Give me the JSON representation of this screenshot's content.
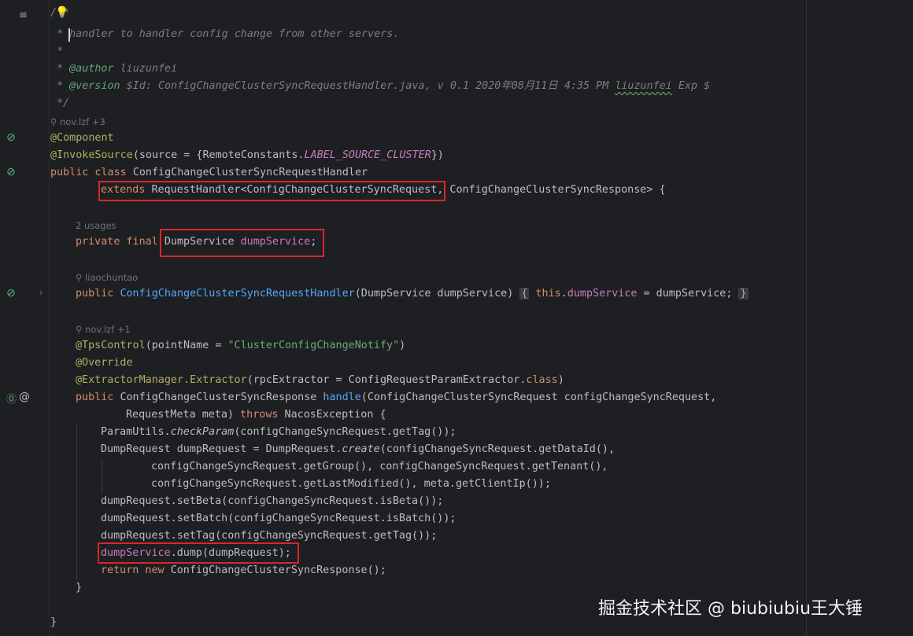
{
  "editor": {
    "lines": {
      "l1": "/**",
      "l2": "* handler to handler config change from other servers.",
      "l3": "*",
      "l4_tag": "@author",
      "l4_val": "liuzunfei",
      "l5_tag": "@version",
      "l5_val": "$Id: ConfigChangeClusterSyncRequestHandler.java, v 0.1 2020年08月11日 4:35 PM ",
      "l5_user": "liuzunfei",
      "l5_tail": " Exp $",
      "l6": "*/",
      "lens1": "nov.lzf +3",
      "l7": "@Component",
      "l8_ann": "@InvokeSource",
      "l8_a": "(source = {RemoteConstants.",
      "l8_const": "LABEL_SOURCE_CLUSTER",
      "l8_b": "})",
      "l9_kw": "public class ",
      "l9_name": "ConfigChangeClusterSyncRequestHandler",
      "l10_kw": "extends ",
      "l10_a": "RequestHandler<ConfigChangeClusterSyncRequest,",
      "l10_b": " ConfigChangeClusterSyncResponse> {",
      "lens2": "2 usages",
      "l11_kw": "private final ",
      "l11_type": "DumpService ",
      "l11_field": "dumpService",
      "l11_end": ";",
      "lens3": "liaochuntao",
      "l12_kw": "public ",
      "l12_ctor": "ConfigChangeClusterSyncRequestHandler",
      "l12_params": "(DumpService dumpService)",
      "l12_fold_open": "{",
      "l12_this": "this",
      "l12_dot": ".",
      "l12_field": "dumpService",
      "l12_assign": " = dumpService;",
      "l12_fold_close": "}",
      "lens4": "nov.lzf +1",
      "l13_ann": "@TpsControl",
      "l13_a": "(pointName = ",
      "l13_str": "\"ClusterConfigChangeNotify\"",
      "l13_b": ")",
      "l14": "@Override",
      "l15_a": "@ExtractorManager.",
      "l15_ann": "Extractor",
      "l15_b": "(rpcExtractor = ConfigRequestParamExtractor.",
      "l15_kw": "class",
      "l15_c": ")",
      "l16_kw": "public ",
      "l16_type": "ConfigChangeClusterSyncResponse ",
      "l16_fn": "handle",
      "l16_b": "(ConfigChangeClusterSyncRequest configChangeSyncRequest,",
      "l17_a": "RequestMeta meta) ",
      "l17_kw": "throws",
      "l17_b": " NacosException {",
      "l18_a": "ParamUtils.",
      "l18_m": "checkParam",
      "l18_b": "(configChangeSyncRequest.getTag());",
      "l19_a": "DumpRequest dumpRequest = DumpRequest.",
      "l19_m": "create",
      "l19_b": "(configChangeSyncRequest.getDataId(),",
      "l20": "configChangeSyncRequest.getGroup(), configChangeSyncRequest.getTenant(),",
      "l21": "configChangeSyncRequest.getLastModified(), meta.getClientIp());",
      "l22": "dumpRequest.setBeta(configChangeSyncRequest.isBeta());",
      "l23": "dumpRequest.setBatch(configChangeSyncRequest.isBatch());",
      "l24": "dumpRequest.setTag(configChangeSyncRequest.getTag());",
      "l25_field": "dumpService",
      "l25_b": ".dump(dumpRequest);",
      "l26_kw": "return new ",
      "l26_b": "ConfigChangeClusterSyncResponse();",
      "l27": "}",
      "l28": "}"
    }
  },
  "watermark": "掘金技术社区 @ biubiubiu王大锤",
  "icons": [
    "structure-icon",
    "bulb-icon",
    "bean-icon",
    "implement-icon",
    "at-icon",
    "fold-arrow-icon"
  ]
}
